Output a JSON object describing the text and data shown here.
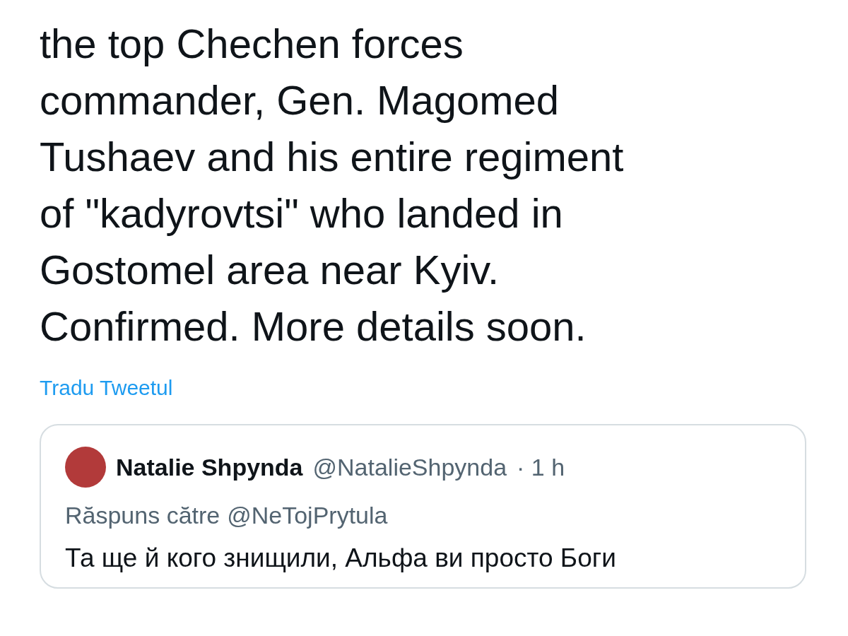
{
  "tweet": {
    "text": "the top Chechen forces\ncommander, Gen. Magomed\nTushaev and his entire regiment\nof \"kadyrovtsi\" who landed in\nGostomel area near Kyiv.\nConfirmed. More details soon.",
    "translate_link": "Tradu Tweetul"
  },
  "quoted_tweet": {
    "name": "Natalie Shpynda",
    "handle": "@NatalieShpynda",
    "time": "· 1 h",
    "reply_to_label": "Răspuns către",
    "reply_to_handle": "@NeTojPrytula",
    "text": "Та ще й кого знищили, Альфа ви просто Боги"
  }
}
